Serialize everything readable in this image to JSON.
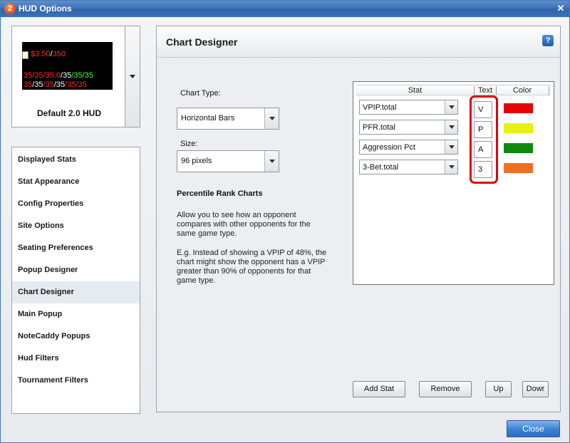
{
  "window": {
    "title": "HUD Options",
    "app_icon": "2"
  },
  "hud": {
    "name": "Default 2.0 HUD",
    "preview_line1": [
      "$3.50",
      "/",
      "350"
    ],
    "preview_line2": [
      "35",
      "/35",
      "/35.0",
      "/35",
      "/35",
      "/35"
    ],
    "preview_line3": [
      "35",
      "/35",
      "/35",
      "/35",
      "/35",
      "/35"
    ]
  },
  "sidebar": {
    "items": [
      {
        "label": "Displayed Stats"
      },
      {
        "label": "Stat Appearance"
      },
      {
        "label": "Config Properties"
      },
      {
        "label": "Site Options"
      },
      {
        "label": "Seating Preferences"
      },
      {
        "label": "Popup Designer"
      },
      {
        "label": "Chart Designer",
        "active": true
      },
      {
        "label": "Main Popup"
      },
      {
        "label": "NoteCaddy Popups"
      },
      {
        "label": "Hud Filters"
      },
      {
        "label": "Tournament Filters"
      }
    ]
  },
  "panel": {
    "title": "Chart Designer",
    "chart_type_label": "Chart Type:",
    "chart_type_value": "Horizontal Bars",
    "size_label": "Size:",
    "size_value": "96 pixels",
    "info_heading": "Percentile Rank Charts",
    "info_para1": "Allow you to see how an opponent compares with other opponents for the same game type.",
    "info_para2": "E.g. Instead of showing a VPIP of 48%, the chart might show the opponent has a VPIP greater than 90% of opponents for that game type."
  },
  "grid": {
    "headers": {
      "stat": "Stat",
      "text": "Text",
      "color": "Color"
    },
    "rows": [
      {
        "stat": "VPIP.total",
        "text": "V",
        "color": "#e60000"
      },
      {
        "stat": "PFR.total",
        "text": "P",
        "color": "#e6f013"
      },
      {
        "stat": "Aggression Pct",
        "text": "A",
        "color": "#0e8a0e"
      },
      {
        "stat": "3-Bet.total",
        "text": "3",
        "color": "#ef7020"
      }
    ],
    "highlight_color": "#e00010"
  },
  "buttons": {
    "add_stat": "Add Stat",
    "remove": "Remove",
    "up": "Up",
    "down": "Dowr",
    "close": "Close"
  }
}
